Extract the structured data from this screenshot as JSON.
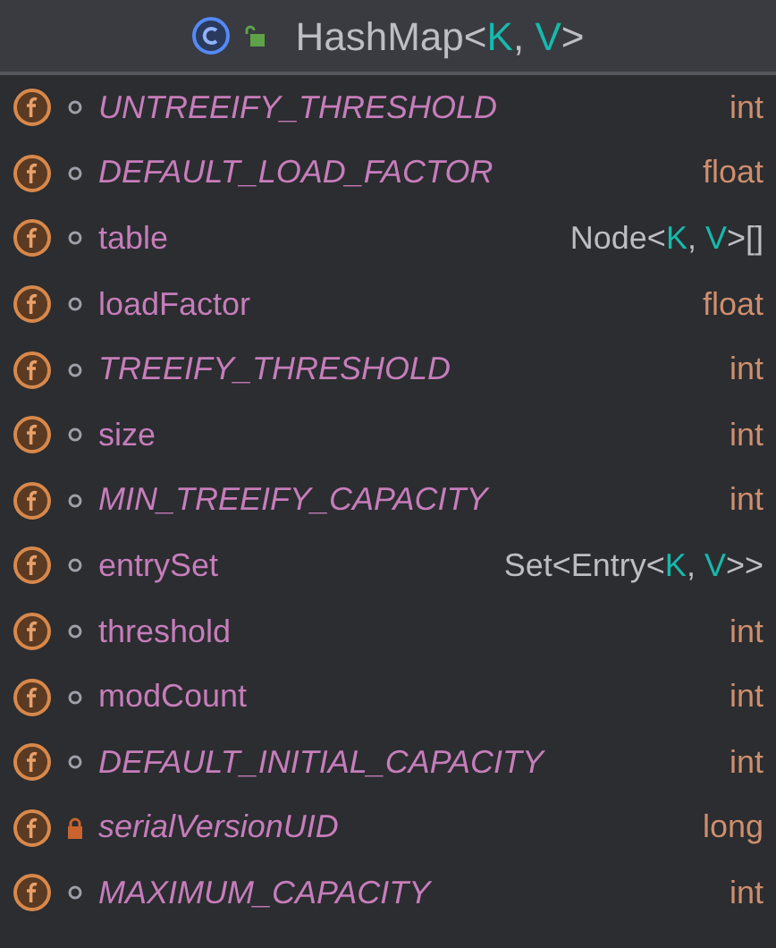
{
  "header": {
    "kind": "class",
    "public": true,
    "title": [
      {
        "text": "HashMap",
        "kind": "class"
      },
      {
        "text": "<",
        "kind": "punct"
      },
      {
        "text": "K",
        "kind": "param"
      },
      {
        "text": ",",
        "kind": "punct"
      },
      {
        "text": " V",
        "kind": "param"
      },
      {
        "text": ">",
        "kind": "punct"
      }
    ]
  },
  "fields": [
    {
      "name": "UNTREEIFY_THRESHOLD",
      "static": true,
      "private": false,
      "type": [
        {
          "text": "int",
          "kind": "primitive"
        }
      ]
    },
    {
      "name": "DEFAULT_LOAD_FACTOR",
      "static": true,
      "private": false,
      "type": [
        {
          "text": "float",
          "kind": "primitive"
        }
      ]
    },
    {
      "name": "table",
      "static": false,
      "private": false,
      "type": [
        {
          "text": "Node",
          "kind": "class"
        },
        {
          "text": "<",
          "kind": "punct"
        },
        {
          "text": "K",
          "kind": "param"
        },
        {
          "text": ",",
          "kind": "punct"
        },
        {
          "text": " V",
          "kind": "param"
        },
        {
          "text": ">[]",
          "kind": "punct"
        }
      ]
    },
    {
      "name": "loadFactor",
      "static": false,
      "private": false,
      "type": [
        {
          "text": "float",
          "kind": "primitive"
        }
      ]
    },
    {
      "name": "TREEIFY_THRESHOLD",
      "static": true,
      "private": false,
      "type": [
        {
          "text": "int",
          "kind": "primitive"
        }
      ]
    },
    {
      "name": "size",
      "static": false,
      "private": false,
      "type": [
        {
          "text": "int",
          "kind": "primitive"
        }
      ]
    },
    {
      "name": "MIN_TREEIFY_CAPACITY",
      "static": true,
      "private": false,
      "type": [
        {
          "text": "int",
          "kind": "primitive"
        }
      ]
    },
    {
      "name": "entrySet",
      "static": false,
      "private": false,
      "type": [
        {
          "text": "Set",
          "kind": "class"
        },
        {
          "text": "<",
          "kind": "punct"
        },
        {
          "text": "Entry",
          "kind": "class"
        },
        {
          "text": "<",
          "kind": "punct"
        },
        {
          "text": "K",
          "kind": "param"
        },
        {
          "text": ",",
          "kind": "punct"
        },
        {
          "text": " V",
          "kind": "param"
        },
        {
          "text": ">>",
          "kind": "punct"
        }
      ]
    },
    {
      "name": "threshold",
      "static": false,
      "private": false,
      "type": [
        {
          "text": "int",
          "kind": "primitive"
        }
      ]
    },
    {
      "name": "modCount",
      "static": false,
      "private": false,
      "type": [
        {
          "text": "int",
          "kind": "primitive"
        }
      ]
    },
    {
      "name": "DEFAULT_INITIAL_CAPACITY",
      "static": true,
      "private": false,
      "type": [
        {
          "text": "int",
          "kind": "primitive"
        }
      ]
    },
    {
      "name": "serialVersionUID",
      "static": true,
      "private": true,
      "type": [
        {
          "text": "long",
          "kind": "primitive"
        }
      ]
    },
    {
      "name": "MAXIMUM_CAPACITY",
      "static": true,
      "private": false,
      "type": [
        {
          "text": "int",
          "kind": "primitive"
        }
      ]
    }
  ]
}
